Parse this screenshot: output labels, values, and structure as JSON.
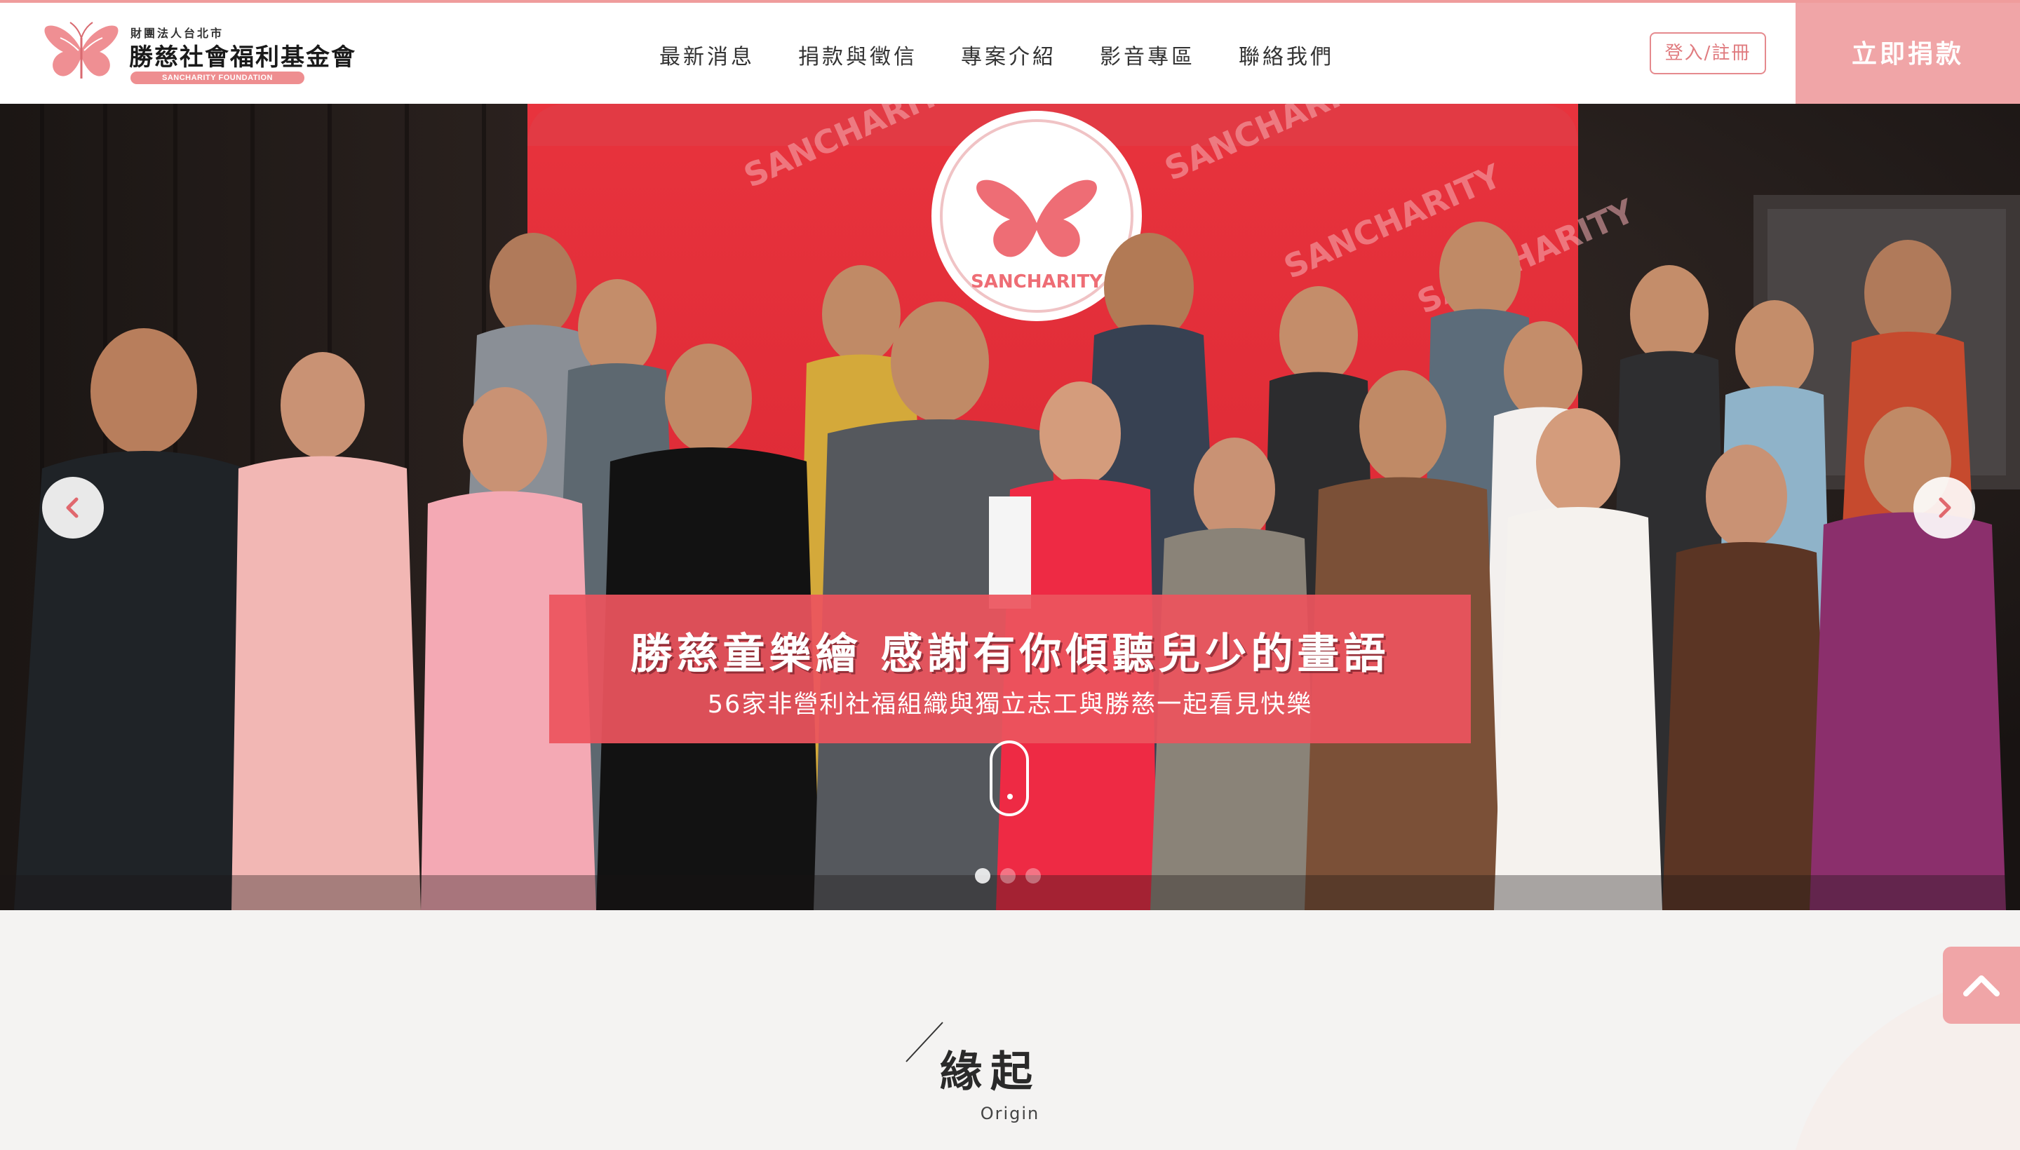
{
  "header": {
    "logo": {
      "small_text": "財團法人台北市",
      "name": "勝慈社會福利基金會",
      "english": "SANCHARITY FOUNDATION",
      "icon": "butterfly-logo"
    },
    "nav": [
      {
        "label": "最新消息"
      },
      {
        "label": "捐款與徵信"
      },
      {
        "label": "專案介紹"
      },
      {
        "label": "影音專區"
      },
      {
        "label": "聯絡我們"
      }
    ],
    "login_label": "登入/註冊",
    "donate_label": "立即捐款"
  },
  "hero": {
    "photo_description_icon": "group-photo",
    "backdrop_brand": "SANCHARITY",
    "caption_title": "勝慈童樂繪 感謝有你傾聽兒少的畫語",
    "caption_subtitle": "56家非營利社福組織與獨立志工與勝慈一起看見快樂",
    "prev_icon": "chevron-left-icon",
    "next_icon": "chevron-right-icon",
    "slide_count": 3,
    "active_slide": 1
  },
  "origin": {
    "title": "緣起",
    "subtitle": "Origin"
  },
  "back_to_top_icon": "chevron-up-icon",
  "colors": {
    "brand_pink": "#f0a5a7",
    "caption_red": "#ec545e",
    "accent_border": "#ef9c9c",
    "page_bg": "#f4f3f2"
  }
}
